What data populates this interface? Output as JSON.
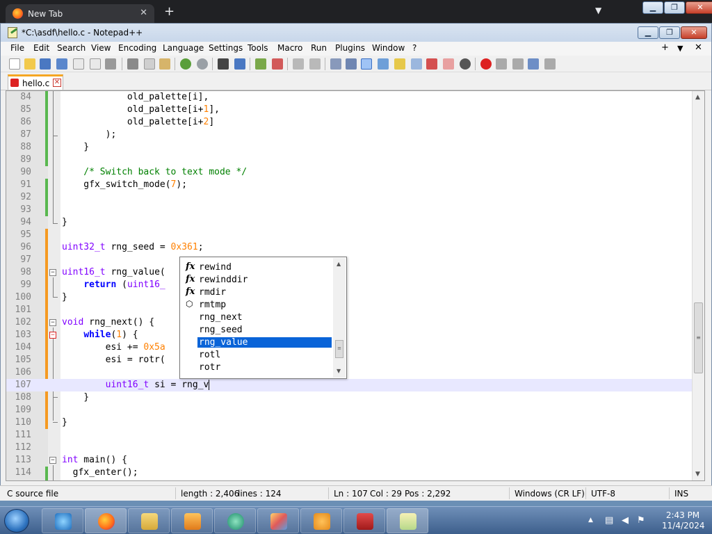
{
  "browser": {
    "tab_title": "New Tab",
    "tab_close": "✕",
    "new_tab": "+",
    "tab_list": "▼"
  },
  "window": {
    "title": "*C:\\asdf\\hello.c - Notepad++",
    "minimize": "▁",
    "maximize": "❐",
    "close": "✕"
  },
  "outer_window": {
    "minimize": "▁",
    "maximize": "❐",
    "close": "✕"
  },
  "menu": {
    "items": [
      "File",
      "Edit",
      "Search",
      "View",
      "Encoding",
      "Language",
      "Settings",
      "Tools",
      "Macro",
      "Run",
      "Plugins",
      "Window",
      "?"
    ],
    "right_plus": "+",
    "right_down": "▼",
    "right_close": "✕"
  },
  "file_tab": {
    "name": "hello.c",
    "close": "✕"
  },
  "editor": {
    "lines": [
      {
        "n": "84",
        "text": "            old_palette[i],"
      },
      {
        "n": "85",
        "text": "            old_palette[i+1],"
      },
      {
        "n": "86",
        "text": "            old_palette[i+2]"
      },
      {
        "n": "87",
        "text": "        );"
      },
      {
        "n": "88",
        "text": "    }"
      },
      {
        "n": "89",
        "text": ""
      },
      {
        "n": "90",
        "text": "    /* Switch back to text mode */"
      },
      {
        "n": "91",
        "text": "    gfx_switch_mode(7);"
      },
      {
        "n": "92",
        "text": ""
      },
      {
        "n": "93",
        "text": ""
      },
      {
        "n": "94",
        "text": "}"
      },
      {
        "n": "95",
        "text": ""
      },
      {
        "n": "96",
        "text": "uint32_t rng_seed = 0x361;"
      },
      {
        "n": "97",
        "text": ""
      },
      {
        "n": "98",
        "text": "uint16_t rng_value("
      },
      {
        "n": "99",
        "text": "    return (uint16_"
      },
      {
        "n": "100",
        "text": "}"
      },
      {
        "n": "101",
        "text": ""
      },
      {
        "n": "102",
        "text": "void rng_next() {"
      },
      {
        "n": "103",
        "text": "    while(1) {"
      },
      {
        "n": "104",
        "text": "        esi += 0x5a"
      },
      {
        "n": "105",
        "text": "        esi = rotr("
      },
      {
        "n": "106",
        "text": ""
      },
      {
        "n": "107",
        "text": "        uint16_t si = rng_v"
      },
      {
        "n": "108",
        "text": "    }"
      },
      {
        "n": "109",
        "text": ""
      },
      {
        "n": "110",
        "text": "}"
      },
      {
        "n": "111",
        "text": ""
      },
      {
        "n": "112",
        "text": ""
      },
      {
        "n": "113",
        "text": "int main() {"
      },
      {
        "n": "114",
        "text": "  gfx_enter();"
      }
    ]
  },
  "autocomplete": {
    "items": [
      {
        "icon": "fx",
        "label": "rewind"
      },
      {
        "icon": "fx",
        "label": "rewinddir"
      },
      {
        "icon": "fx",
        "label": "rmdir"
      },
      {
        "icon": "cube",
        "label": "rmtmp"
      },
      {
        "icon": "",
        "label": "rng_next"
      },
      {
        "icon": "",
        "label": "rng_seed"
      },
      {
        "icon": "",
        "label": "rng_value"
      },
      {
        "icon": "",
        "label": "rotl"
      },
      {
        "icon": "",
        "label": "rotr"
      }
    ],
    "selected": "rng_value"
  },
  "status": {
    "filetype": "C source file",
    "length": "length : 2,406",
    "lines": "lines : 124",
    "ln": "Ln : 107",
    "col": "Col : 29",
    "pos": "Pos : 2,292",
    "eol": "Windows (CR LF)",
    "encoding": "UTF-8",
    "mode": "INS"
  },
  "taskbar": {
    "time": "2:43 PM",
    "date": "11/4/2024",
    "tray_chevron": "▲"
  },
  "colors": {
    "keyword": "#0000ff",
    "type": "#8000ff",
    "number": "#ff8000",
    "comment": "#008000",
    "selection": "#0a64d8",
    "current_line": "#e8e8ff"
  }
}
